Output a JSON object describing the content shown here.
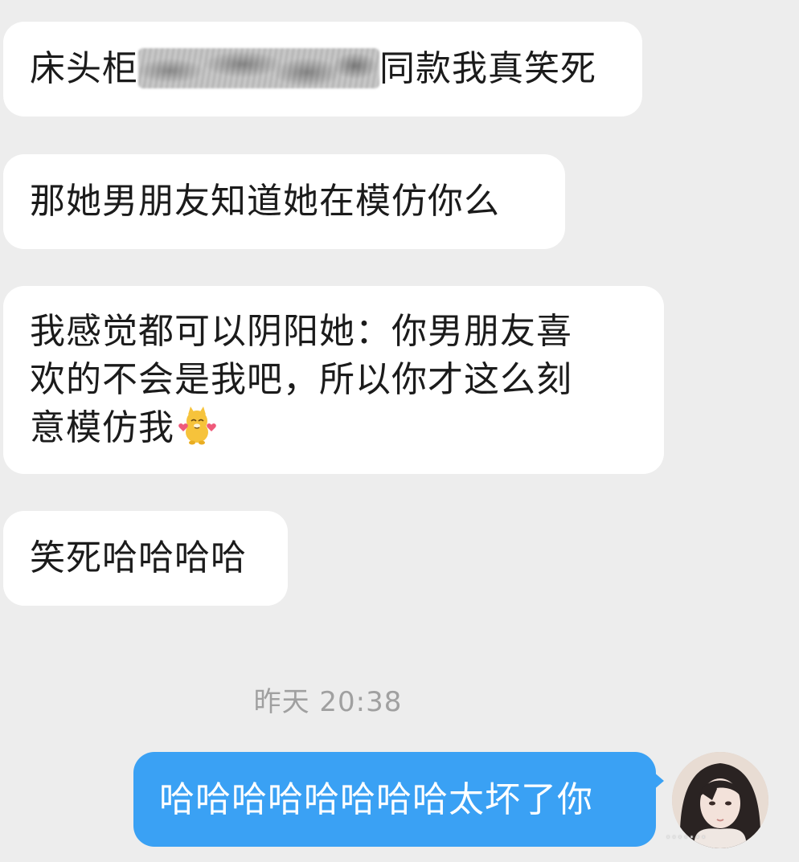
{
  "messages": {
    "m1": {
      "before": "床头柜",
      "after": "同款我真笑死"
    },
    "m2": {
      "text": "那她男朋友知道她在模仿你么"
    },
    "m3": {
      "line1": "我感觉都可以阴阳她：你男朋友喜",
      "line2": "欢的不会是我吧，所以你才这么刻",
      "line3": "意模仿我"
    },
    "m4": {
      "text": "笑死哈哈哈哈"
    },
    "timestamp": "昨天 20:38",
    "m5": {
      "text": "哈哈哈哈哈哈哈哈太坏了你"
    }
  },
  "colors": {
    "background": "#ededed",
    "incoming_bubble": "#ffffff",
    "outgoing_bubble": "#3aa1f4",
    "timestamp": "#a0a0a0"
  },
  "icons": {
    "sticker": "cat-with-hearts-emoji",
    "avatar": "contact-avatar-photo"
  }
}
